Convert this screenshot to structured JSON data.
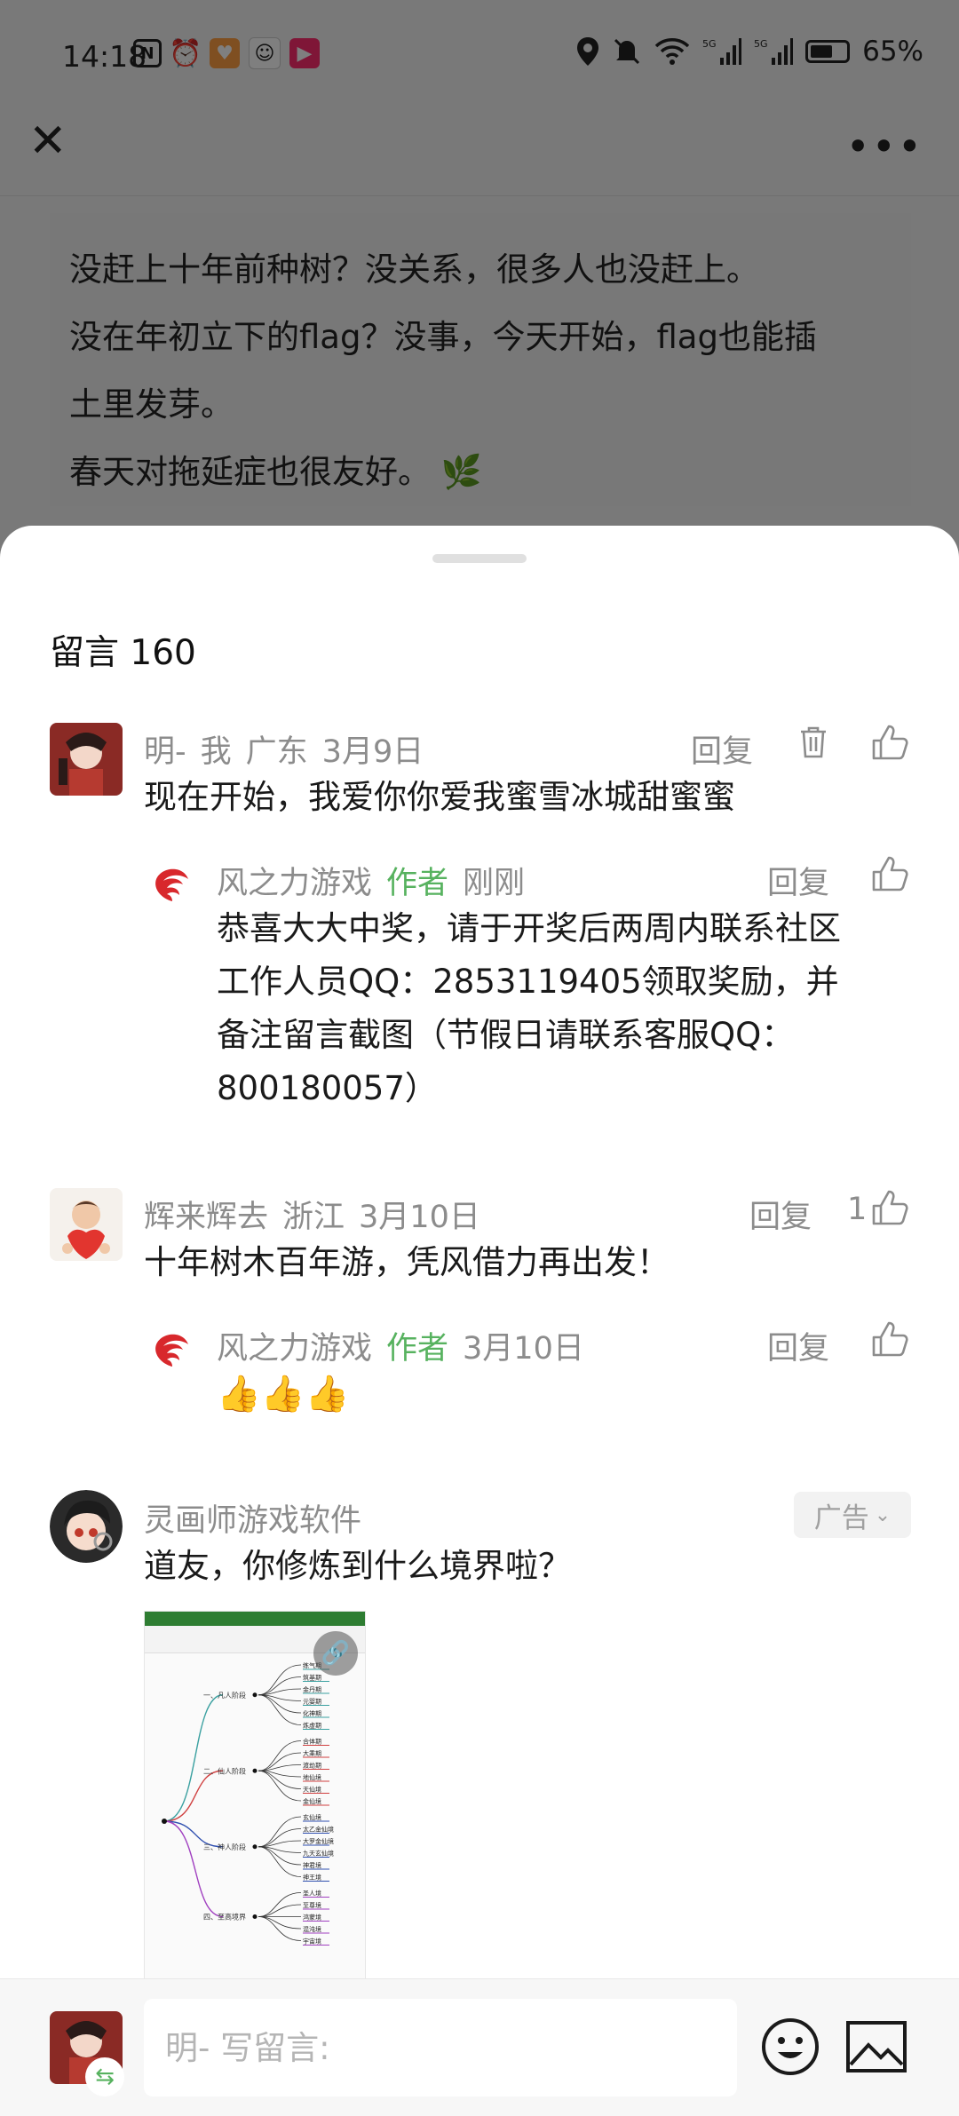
{
  "status_bar": {
    "time": "14:18",
    "battery": "65%",
    "icons": [
      "nfc-icon",
      "alarm-icon",
      "app-heart-icon",
      "app-avatar-icon",
      "app-video-icon",
      "location-icon",
      "mute-icon",
      "wifi-icon",
      "signal-5g-icon",
      "signal-5g-icon",
      "battery-icon"
    ]
  },
  "article": {
    "lines": [
      "没赶上十年前种树？没关系，很多人也没赶上。",
      "没在年初立下的flag？没事，今天开始，flag也能插",
      "土里发芽。",
      "春天对拖延症也很友好。 🌿"
    ]
  },
  "comments_header": {
    "label": "留言",
    "count": "160"
  },
  "comments": [
    {
      "author": "明-",
      "self_tag": "我",
      "location": "广东",
      "date": "3月9日",
      "reply_label": "回复",
      "text": "现在开始，我爱你你爱我蜜雪冰城甜蜜蜜",
      "reply": {
        "author": "风之力游戏",
        "author_tag": "作者",
        "date": "刚刚",
        "reply_label": "回复",
        "lines": [
          "恭喜大大中奖，请于开奖后两周内联系社区",
          "工作人员QQ：2853119405领取奖励，并",
          "备注留言截图（节假日请联系客服QQ：",
          "800180057）"
        ]
      }
    },
    {
      "author": "辉来辉去",
      "location": "浙江",
      "date": "3月10日",
      "reply_label": "回复",
      "like_count": "1",
      "text": "十年树木百年游，凭风借力再出发！",
      "reply": {
        "author": "风之力游戏",
        "author_tag": "作者",
        "date": "3月10日",
        "reply_label": "回复",
        "text": "👍👍👍"
      }
    },
    {
      "author": "灵画师游戏软件",
      "ad_label": "广告",
      "text": "道友，你修炼到什么境界啦？",
      "image": {
        "stages": [
          "一、凡人阶段",
          "二、仙人阶段",
          "三、神人阶段",
          "四、至高境界"
        ],
        "stage_colors": [
          "#3aa0a0",
          "#d04040",
          "#3050b0",
          "#a040c0"
        ],
        "leaves": [
          [
            "练气期",
            "筑基期",
            "金丹期",
            "元婴期",
            "化神期",
            "炼虚期"
          ],
          [
            "合体期",
            "大乘期",
            "渡劫期",
            "地仙境",
            "天仙境",
            "金仙境"
          ],
          [
            "玄仙境",
            "太乙金仙境",
            "大罗金仙境",
            "九天玄仙境",
            "神君境",
            "神王境"
          ],
          [
            "圣人境",
            "至尊境",
            "鸿蒙境",
            "混沌境",
            "宇宙境"
          ]
        ]
      }
    }
  ],
  "input_bar": {
    "placeholder": "明- 写留言:"
  }
}
